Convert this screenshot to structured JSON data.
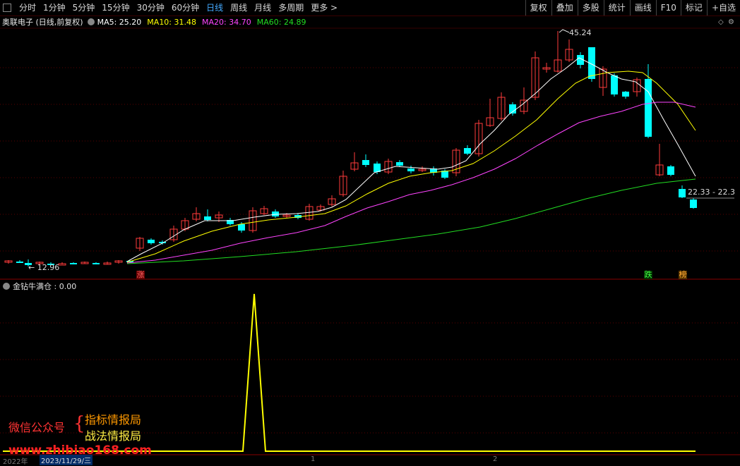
{
  "toolbar": {
    "periods": [
      "分时",
      "1分钟",
      "5分钟",
      "15分钟",
      "30分钟",
      "60分钟",
      "日线",
      "周线",
      "月线",
      "多周期",
      "更多 >"
    ],
    "active": "日线",
    "buttons": [
      "复权",
      "叠加",
      "多股",
      "统计",
      "画线",
      "F10",
      "标记",
      "+自选"
    ]
  },
  "legend": {
    "stock": "奥联电子 (日线,前复权)",
    "ma5": "MA5: 25.20",
    "ma10": "MA10: 31.48",
    "ma20": "MA20: 34.70",
    "ma60": "MA60: 24.89",
    "colors": {
      "ma5": "#ffffff",
      "ma10": "#ffff00",
      "ma20": "#ff44ff",
      "ma60": "#22dd22"
    }
  },
  "labels": {
    "high": "45.24",
    "low": "← 12.96",
    "price_box": "22.33 - 22.3",
    "tag_up": "涨",
    "tag_down": "跌",
    "tag_list": "榜"
  },
  "indicator": {
    "title": "金钻牛满仓 : 0.00",
    "color": "#ffff00"
  },
  "watermark": {
    "left": "微信公众号",
    "brace": "{",
    "line1": "指标情报局",
    "line2": "战法情报局",
    "url": "www.zhibiao168.com"
  },
  "date_bar": {
    "year": "2022年",
    "date": "2023/11/29/三",
    "m1": "1",
    "m2": "2"
  }
}
